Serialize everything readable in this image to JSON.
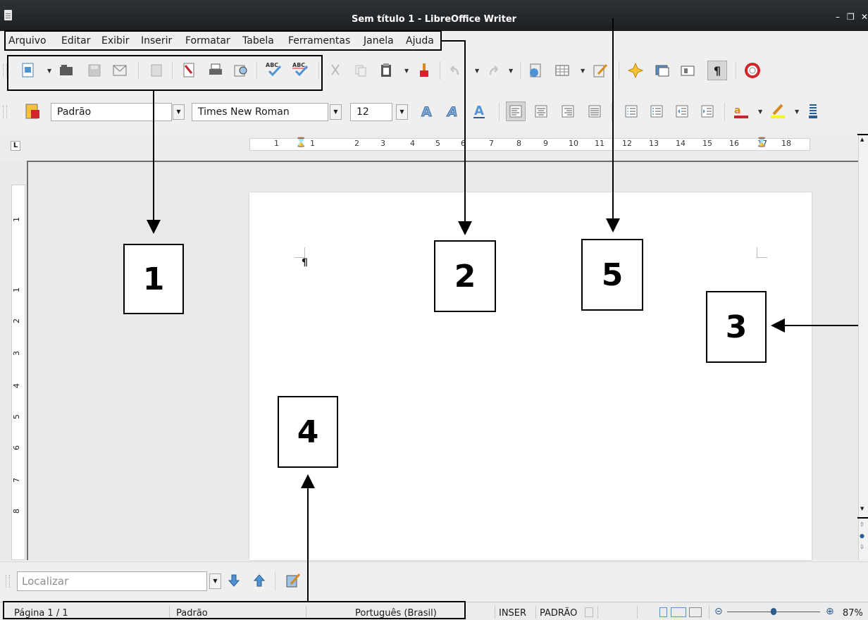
{
  "window": {
    "title": "Sem título 1 - LibreOffice Writer"
  },
  "menu": [
    "Arquivo",
    "Editar",
    "Exibir",
    "Inserir",
    "Formatar",
    "Tabela",
    "Ferramentas",
    "Janela",
    "Ajuda"
  ],
  "formatting": {
    "style": "Padrão",
    "font": "Times New Roman",
    "size": "12"
  },
  "ruler": {
    "h_ticks": [
      "1",
      "1",
      "2",
      "3",
      "4",
      "5",
      "6",
      "7",
      "8",
      "9",
      "10",
      "11",
      "12",
      "13",
      "14",
      "15",
      "16",
      "17",
      "18"
    ],
    "v_ticks": [
      "1",
      "1",
      "2",
      "3",
      "4",
      "5",
      "6",
      "7",
      "8"
    ]
  },
  "document": {
    "paragraph_mark": "¶"
  },
  "find": {
    "placeholder": "Localizar"
  },
  "status": {
    "page": "Página 1 / 1",
    "style": "Padrão",
    "language": "Português (Brasil)",
    "mode": "INSER",
    "selection": "PADRÃO",
    "zoom": "87%"
  },
  "annotations": [
    "1",
    "2",
    "3",
    "4",
    "5"
  ],
  "colors": {
    "annotation": "#000000",
    "titlebar": "#1f2225",
    "page": "#ffffff"
  }
}
